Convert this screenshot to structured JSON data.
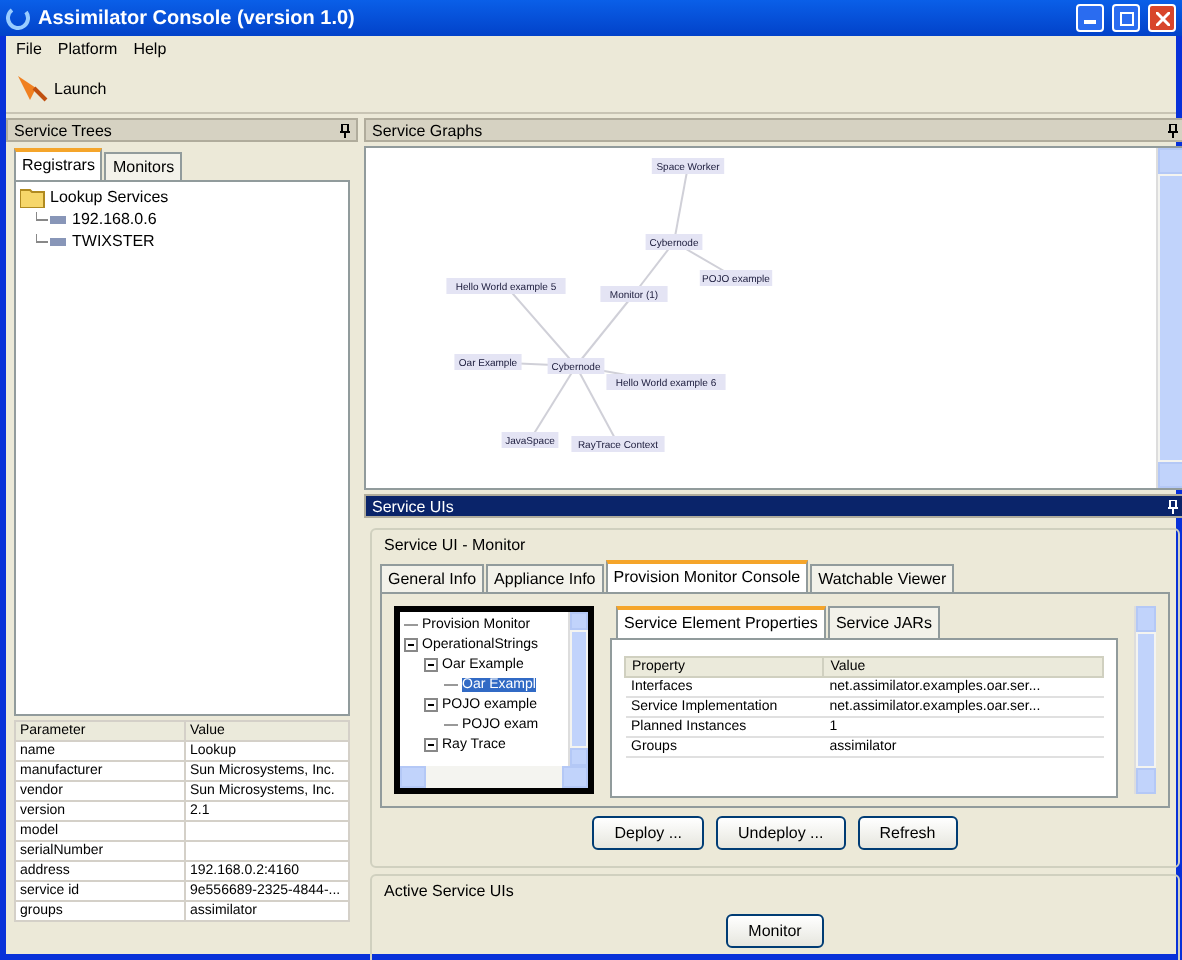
{
  "window": {
    "title": "Assimilator Console (version 1.0)"
  },
  "menu": [
    "File",
    "Platform",
    "Help"
  ],
  "toolbar": [
    {
      "label": "Launch"
    }
  ],
  "service_trees": {
    "title": "Service Trees",
    "tabs": [
      {
        "label": "Registrars",
        "selected": true
      },
      {
        "label": "Monitors",
        "selected": false
      }
    ],
    "tree": [
      {
        "label": "Lookup Services",
        "expanded": true,
        "children": [
          {
            "label": "192.168.0.6"
          },
          {
            "label": "TWIXSTER"
          }
        ]
      }
    ],
    "table": {
      "columns": [
        "Parameter",
        "Value"
      ],
      "rows": [
        [
          "name",
          "Lookup"
        ],
        [
          "manufacturer",
          "Sun Microsystems, Inc."
        ],
        [
          "vendor",
          "Sun Microsystems, Inc."
        ],
        [
          "version",
          "2.1"
        ],
        [
          "model",
          ""
        ],
        [
          "serialNumber",
          ""
        ],
        [
          "address",
          "192.168.0.2:4160"
        ],
        [
          "service id",
          "9e556689-2325-4844-..."
        ],
        [
          "groups",
          "assimilator"
        ]
      ]
    }
  },
  "service_graphs": {
    "title": "Service Graphs",
    "nodes": [
      "Space Worker",
      "Cybernode",
      "POJO example",
      "Hello World example 5",
      "Monitor (1)",
      "Oar Example",
      "Cybernode",
      "Hello World example 6",
      "JavaSpace",
      "RayTrace Context"
    ]
  },
  "service_uis": {
    "title": "Service UIs",
    "group_title": "Service UI - Monitor",
    "tabs": [
      {
        "label": "General Info",
        "selected": false
      },
      {
        "label": "Appliance Info",
        "selected": false
      },
      {
        "label": "Provision Monitor Console",
        "selected": true
      },
      {
        "label": "Watchable Viewer",
        "selected": false
      }
    ],
    "tree": [
      {
        "label": "Provision Monitor",
        "selected": false
      },
      {
        "label": "OperationalStrings",
        "selected": false,
        "expanded": true,
        "children": [
          {
            "label": "Oar Example",
            "selected": false,
            "expanded": true,
            "children": [
              {
                "label": "Oar Exampl",
                "selected": true
              }
            ]
          },
          {
            "label": "POJO example",
            "selected": false,
            "expanded": true,
            "children": [
              {
                "label": "POJO exam",
                "selected": false
              }
            ]
          },
          {
            "label": "Ray Trace",
            "selected": false,
            "expanded": true
          }
        ]
      }
    ],
    "inner_tabs": [
      {
        "label": "Service Element Properties",
        "selected": true
      },
      {
        "label": "Service JARs",
        "selected": false
      }
    ],
    "table": {
      "columns": [
        "Property",
        "Value"
      ],
      "rows": [
        [
          "Interfaces",
          "net.assimilator.examples.oar.ser..."
        ],
        [
          "Service Implementation",
          "net.assimilator.examples.oar.ser..."
        ],
        [
          "Planned Instances",
          "1"
        ],
        [
          "Groups",
          "assimilator"
        ]
      ]
    },
    "buttons": [
      "Deploy ...",
      "Undeploy ...",
      "Refresh"
    ],
    "active_title": "Active Service UIs",
    "active_buttons": [
      "Monitor"
    ]
  }
}
